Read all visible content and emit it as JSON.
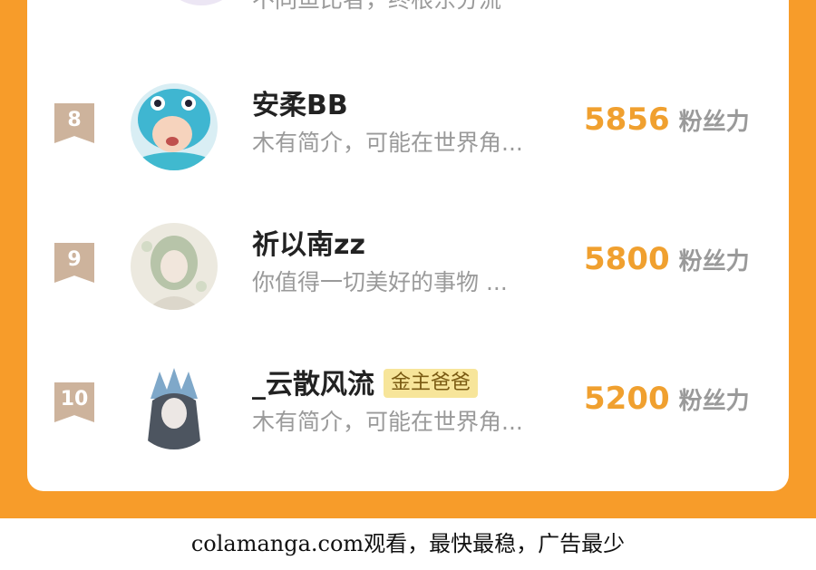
{
  "partial_row": {
    "bio": "不同鱼比者，终根东分流"
  },
  "rows": [
    {
      "rank": "8",
      "name": "安柔BB",
      "bio": "木有简介，可能在世界角...",
      "score": "5856",
      "unit": "粉丝力"
    },
    {
      "rank": "9",
      "name": "祈以南zz",
      "bio": "你值得一切美好的事物 ...",
      "score": "5800",
      "unit": "粉丝力"
    },
    {
      "rank": "10",
      "name": "_云散风流",
      "badge": "金主爸爸",
      "bio": "木有简介，可能在世界角...",
      "score": "5200",
      "unit": "粉丝力"
    }
  ],
  "footer": {
    "text": "colamanga.com观看，最快最稳，广告最少"
  },
  "colors": {
    "orange": "#F79C2A",
    "score": "#F0A02F",
    "rank_badge": "#CDB39C",
    "tag": "#F7E59A"
  }
}
